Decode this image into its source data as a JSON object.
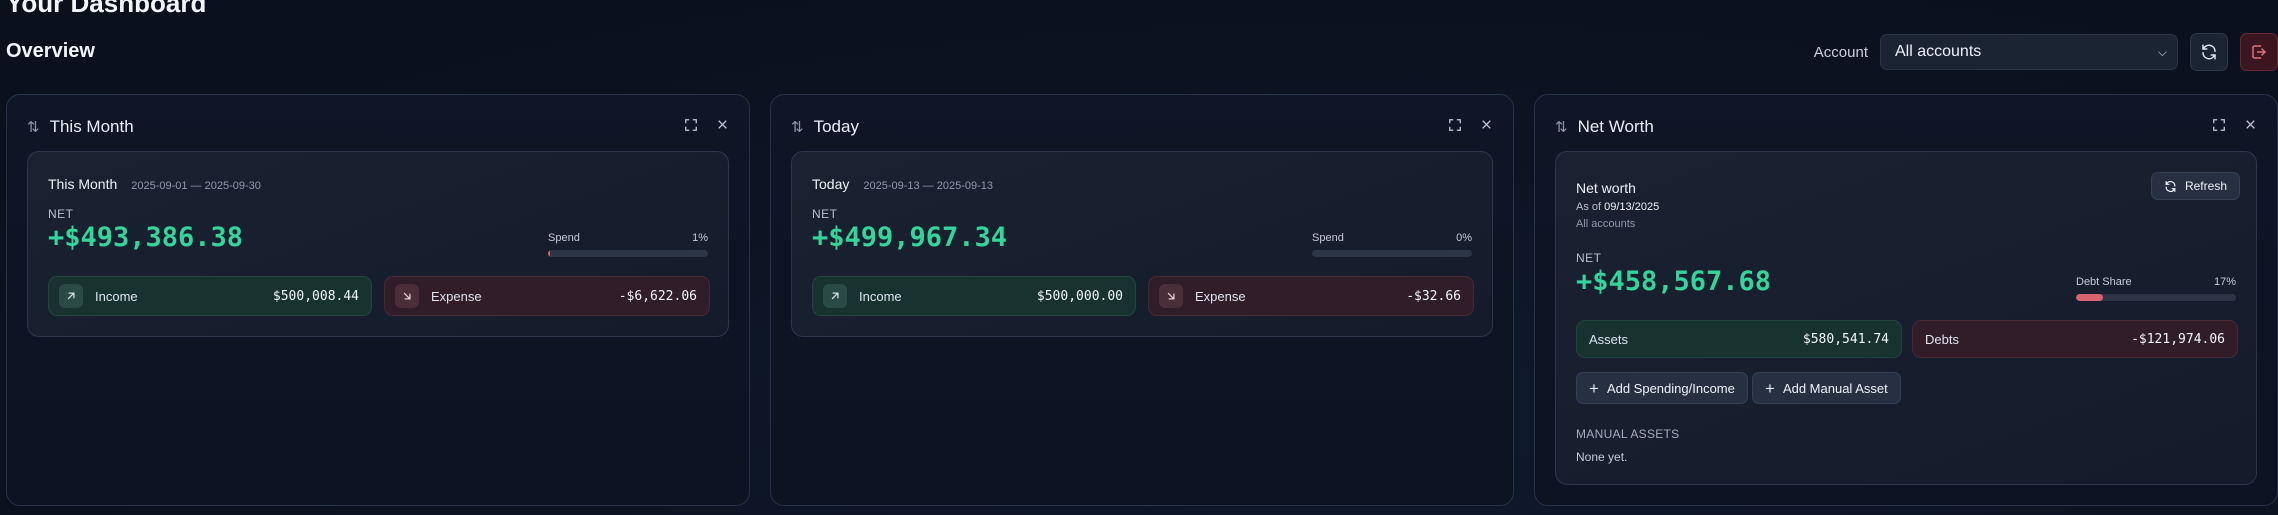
{
  "header": {
    "page_title": "Your Dashboard",
    "section_title": "Overview",
    "account_label": "Account",
    "account_selected": "All accounts"
  },
  "icons": {
    "refresh": "refresh-icon",
    "logout": "logout-icon",
    "sort": "sort-arrows-icon",
    "expand": "expand-icon",
    "close": "close-icon",
    "income": "arrow-up-right-icon",
    "expense": "arrow-down-right-icon",
    "plus": "plus-icon"
  },
  "colors": {
    "positive": "#34d49a",
    "spend_bar": "#d7636f",
    "danger": "#d7636f"
  },
  "panels": [
    {
      "title": "This Month",
      "card": {
        "name": "This Month",
        "range": "2025-09-01 — 2025-09-30",
        "net_label": "NET",
        "net_value": "+$493,386.38",
        "spend_label": "Spend",
        "spend_pct": "1%",
        "spend_fraction": 0.01,
        "income_label": "Income",
        "income_value": "$500,008.44",
        "expense_label": "Expense",
        "expense_value": "-$6,622.06"
      }
    },
    {
      "title": "Today",
      "card": {
        "name": "Today",
        "range": "2025-09-13 — 2025-09-13",
        "net_label": "NET",
        "net_value": "+$499,967.34",
        "spend_label": "Spend",
        "spend_pct": "0%",
        "spend_fraction": 0,
        "income_label": "Income",
        "income_value": "$500,000.00",
        "expense_label": "Expense",
        "expense_value": "-$32.66"
      }
    },
    {
      "title": "Net Worth",
      "card": {
        "name": "Net worth",
        "as_of_prefix": "As of",
        "as_of_date": "09/13/2025",
        "accounts": "All accounts",
        "refresh_label": "Refresh",
        "net_label": "NET",
        "net_value": "+$458,567.68",
        "debt_label": "Debt Share",
        "debt_pct": "17%",
        "debt_fraction": 0.17,
        "assets_label": "Assets",
        "assets_value": "$580,541.74",
        "debts_label": "Debts",
        "debts_value": "-$121,974.06",
        "add_spending_label": "Add Spending/Income",
        "add_asset_label": "Add Manual Asset",
        "manual_assets_label": "MANUAL ASSETS",
        "manual_assets_empty": "None yet."
      }
    }
  ]
}
